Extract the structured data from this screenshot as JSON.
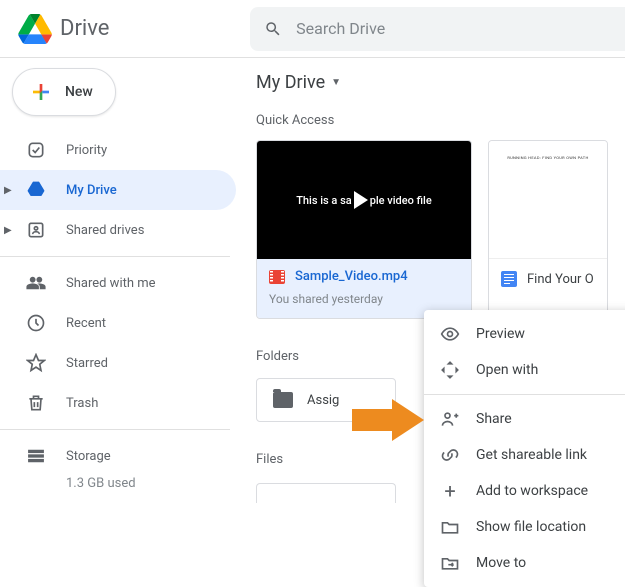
{
  "header": {
    "brand": "Drive",
    "search_placeholder": "Search Drive"
  },
  "sidebar": {
    "new_label": "New",
    "items": [
      {
        "label": "Priority"
      },
      {
        "label": "My Drive"
      },
      {
        "label": "Shared drives"
      }
    ],
    "sec2": [
      {
        "label": "Shared with me"
      },
      {
        "label": "Recent"
      },
      {
        "label": "Starred"
      },
      {
        "label": "Trash"
      }
    ],
    "storage": {
      "label": "Storage",
      "used": "1.3 GB used"
    }
  },
  "main": {
    "breadcrumb": "My Drive",
    "quick_access": "Quick Access",
    "card1": {
      "thumb_text_left": "This is a sa",
      "thumb_text_right": "ple video file",
      "title": "Sample_Video.mp4",
      "sub": "You shared yesterday"
    },
    "card2": {
      "thumb_text": "RUNNING HEAD: FIND YOUR OWN PATH",
      "title": "Find Your O"
    },
    "folders_label": "Folders",
    "folder1": "Assig",
    "files_label": "Files"
  },
  "ctx": {
    "preview": "Preview",
    "open_with": "Open with",
    "share": "Share",
    "get_link": "Get shareable link",
    "add_workspace": "Add to workspace",
    "show_location": "Show file location",
    "move_to": "Move to"
  }
}
